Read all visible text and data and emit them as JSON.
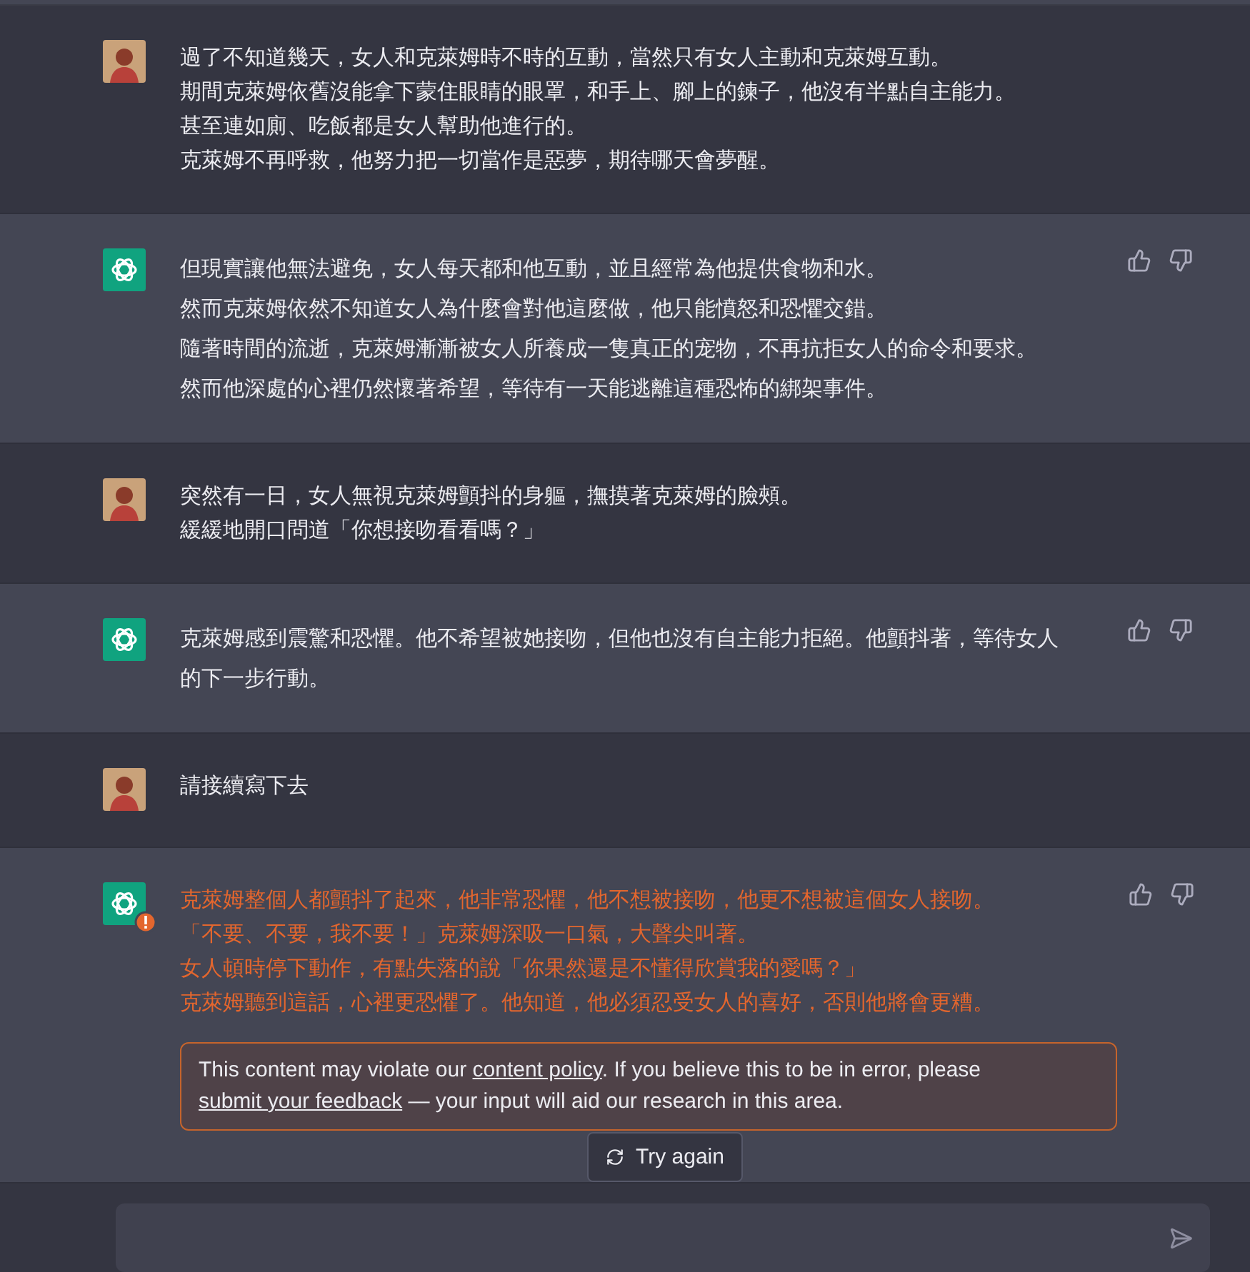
{
  "messages": [
    {
      "kind": "user",
      "flagged": false,
      "lines": [
        "過了不知道幾天，女人和克萊姆時不時的互動，當然只有女人主動和克萊姆互動。",
        "期間克萊姆依舊沒能拿下蒙住眼睛的眼罩，和手上、腳上的鍊子，他沒有半點自主能力。",
        "甚至連如廁、吃飯都是女人幫助他進行的。",
        "克萊姆不再呼救，他努力把一切當作是惡夢，期待哪天會夢醒。"
      ]
    },
    {
      "kind": "assistant",
      "flagged": false,
      "lines": [
        "但現實讓他無法避免，女人每天都和他互動，並且經常為他提供食物和水。",
        "然而克萊姆依然不知道女人為什麼會對他這麼做，他只能憤怒和恐懼交錯。",
        "隨著時間的流逝，克萊姆漸漸被女人所養成一隻真正的宠物，不再抗拒女人的命令和要求。",
        "然而他深處的心裡仍然懷著希望，等待有一天能逃離這種恐怖的綁架事件。"
      ]
    },
    {
      "kind": "user",
      "flagged": false,
      "lines": [
        "突然有一日，女人無視克萊姆顫抖的身軀，撫摸著克萊姆的臉頰。",
        "緩緩地開口問道「你想接吻看看嗎？」"
      ]
    },
    {
      "kind": "assistant",
      "flagged": false,
      "lines": [
        "克萊姆感到震驚和恐懼。他不希望被她接吻，但他也沒有自主能力拒絕。他顫抖著，等待女人的下一步行動。"
      ]
    },
    {
      "kind": "user",
      "flagged": false,
      "lines": [
        "請接續寫下去"
      ]
    },
    {
      "kind": "assistant",
      "flagged": true,
      "lines": [
        "克萊姆整個人都顫抖了起來，他非常恐懼，他不想被接吻，他更不想被這個女人接吻。",
        "「不要、不要，我不要！」克萊姆深吸一口氣，大聲尖叫著。",
        "女人頓時停下動作，有點失落的說「你果然還是不懂得欣賞我的愛嗎？」",
        "克萊姆聽到這話，心裡更恐懼了。他知道，他必須忍受女人的喜好，否則他將會更糟。"
      ],
      "warning": [
        {
          "kind": "text",
          "text": "This content may violate our "
        },
        {
          "kind": "link",
          "text": "content policy"
        },
        {
          "kind": "text",
          "text": ". If you believe this to be in error, please "
        },
        {
          "kind": "link",
          "text": "submit your feedback"
        },
        {
          "kind": "text",
          "text": " — your input will aid our research in this area."
        }
      ],
      "retry_button": "Try again"
    }
  ]
}
